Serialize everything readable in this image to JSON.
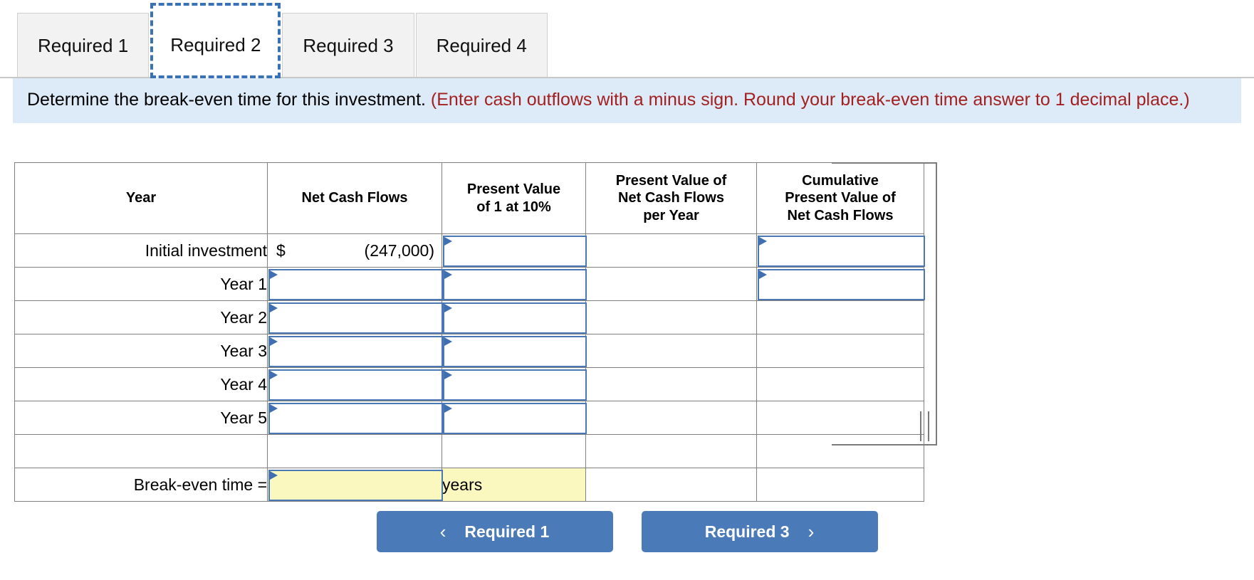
{
  "tabs": {
    "items": [
      {
        "label": "Required 1",
        "active": false
      },
      {
        "label": "Required 2",
        "active": true
      },
      {
        "label": "Required 3",
        "active": false
      },
      {
        "label": "Required 4",
        "active": false
      }
    ]
  },
  "instruction": {
    "main": "Determine the break-even time for this investment.",
    "note": "(Enter cash outflows with a minus sign. Round your break-even time answer to 1 decimal place.)"
  },
  "table": {
    "headers": [
      "Year",
      "Net Cash Flows",
      "Present Value of 1 at 10%",
      "Present Value of Net Cash Flows per Year",
      "Cumulative Present Value of Net Cash Flows"
    ],
    "headers_lines": {
      "h0": [
        "Year"
      ],
      "h1": [
        "Net Cash Flows"
      ],
      "h2": [
        "Present Value",
        "of 1 at 10%"
      ],
      "h3": [
        "Present Value of",
        "Net Cash Flows",
        "per Year"
      ],
      "h4": [
        "Cumulative",
        "Present Value of",
        "Net Cash Flows"
      ]
    },
    "rows": [
      {
        "label": "Initial investment",
        "net_cash_flows_currency": "$",
        "net_cash_flows_value": "(247,000)",
        "net_cash_flows_is_input": false,
        "pv_factor": "",
        "pv_net_cash_flows": "",
        "cumulative_pv": "",
        "cumulative_is_input": true
      },
      {
        "label": "Year 1",
        "net_cash_flows_value": "",
        "net_cash_flows_is_input": true,
        "pv_factor": "",
        "pv_net_cash_flows": "",
        "cumulative_pv": "",
        "cumulative_is_input": true
      },
      {
        "label": "Year 2",
        "net_cash_flows_value": "",
        "net_cash_flows_is_input": true,
        "pv_factor": "",
        "pv_net_cash_flows": "",
        "cumulative_pv": "",
        "cumulative_is_input": false
      },
      {
        "label": "Year 3",
        "net_cash_flows_value": "",
        "net_cash_flows_is_input": true,
        "pv_factor": "",
        "pv_net_cash_flows": "",
        "cumulative_pv": "",
        "cumulative_is_input": false
      },
      {
        "label": "Year 4",
        "net_cash_flows_value": "",
        "net_cash_flows_is_input": true,
        "pv_factor": "",
        "pv_net_cash_flows": "",
        "cumulative_pv": "",
        "cumulative_is_input": false
      },
      {
        "label": "Year 5",
        "net_cash_flows_value": "",
        "net_cash_flows_is_input": true,
        "pv_factor": "",
        "pv_net_cash_flows": "",
        "cumulative_pv": "",
        "cumulative_is_input": false
      }
    ],
    "total_row": {
      "label": "",
      "net_cash_flows_value": "",
      "pv_factor": ""
    },
    "breakeven_row": {
      "label": "Break-even time =",
      "value": "",
      "unit": "years"
    }
  },
  "nav": {
    "prev_label": "Required 1",
    "next_label": "Required 3",
    "prev_icon": "chevron-left-icon",
    "next_icon": "chevron-right-icon",
    "prev_chevron": "‹",
    "next_chevron": "›"
  },
  "colors": {
    "accent": "#4a7ab8",
    "header_bg": "#b3bbd4",
    "instruction_bg": "#ddeaf7",
    "note_red": "#a32020",
    "input_border": "#4a78b5",
    "highlight_yellow": "#fbf8bf"
  }
}
